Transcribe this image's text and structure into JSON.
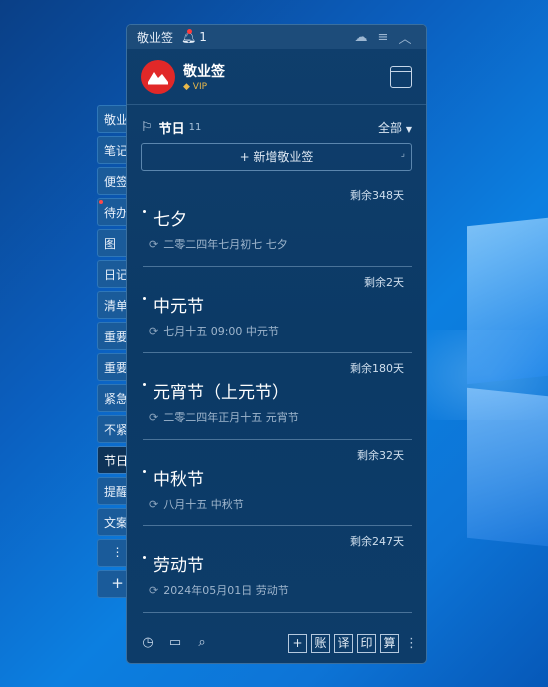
{
  "titlebar": {
    "app_name": "敬业签",
    "notif_count": "1",
    "icons": [
      "cloud-icon",
      "menu-icon",
      "collapse-icon"
    ]
  },
  "header": {
    "app_name": "敬业签",
    "badge": "VIP",
    "icons": [
      "logo-icon",
      "calendar-icon"
    ]
  },
  "side_tabs": [
    "敬业",
    "笔记",
    "便签",
    "待办",
    "图",
    "日记",
    "清单",
    "重要",
    "重要",
    "紧急",
    "不紧",
    "节日",
    "提醒",
    "文案",
    "⋮",
    "+"
  ],
  "section": {
    "title": "节日",
    "count": "11",
    "filter": "全部",
    "add_label": "+ 新增敬业签"
  },
  "items": [
    {
      "remain": "剩余348天",
      "title": "七夕",
      "sub": "二零二四年七月初七 七夕"
    },
    {
      "remain": "剩余2天",
      "title": "中元节",
      "sub": "七月十五 09:00 中元节"
    },
    {
      "remain": "剩余180天",
      "title": "元宵节（上元节）",
      "sub": "二零二四年正月十五 元宵节"
    },
    {
      "remain": "剩余32天",
      "title": "中秋节",
      "sub": "八月十五 中秋节"
    },
    {
      "remain": "剩余247天",
      "title": "劳动节",
      "sub": "2024年05月01日 劳动节"
    }
  ],
  "footer": {
    "buttons": [
      "+",
      "账",
      "译",
      "印",
      "算"
    ],
    "icons": [
      "clock-icon",
      "inbox-icon",
      "search-icon",
      "more-icon"
    ]
  },
  "colors": {
    "brand_red": "#e12828",
    "panel_bg": "#0c3a66",
    "vip_gold": "#e8b84a"
  }
}
